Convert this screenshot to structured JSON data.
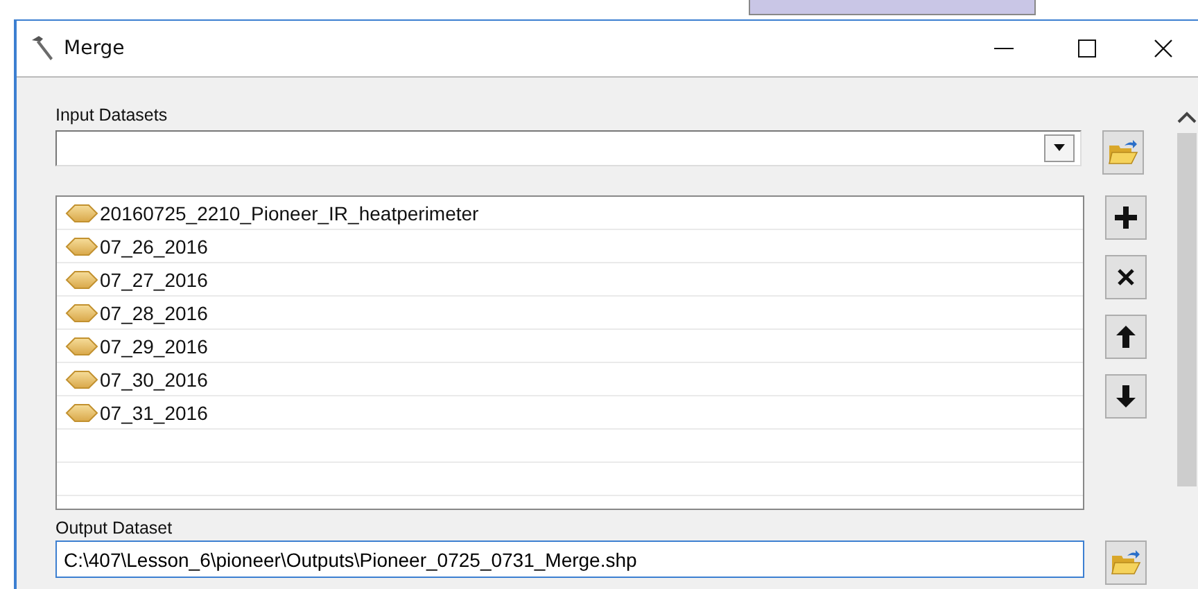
{
  "window": {
    "title": "Merge"
  },
  "input_datasets": {
    "label": "Input Datasets",
    "items": [
      "20160725_2210_Pioneer_IR_heatperimeter",
      "07_26_2016",
      "07_27_2016",
      "07_28_2016",
      "07_29_2016",
      "07_30_2016",
      "07_31_2016"
    ]
  },
  "output_dataset": {
    "label": "Output Dataset",
    "value": "C:\\407\\Lesson_6\\pioneer\\Outputs\\Pioneer_0725_0731_Merge.shp"
  }
}
